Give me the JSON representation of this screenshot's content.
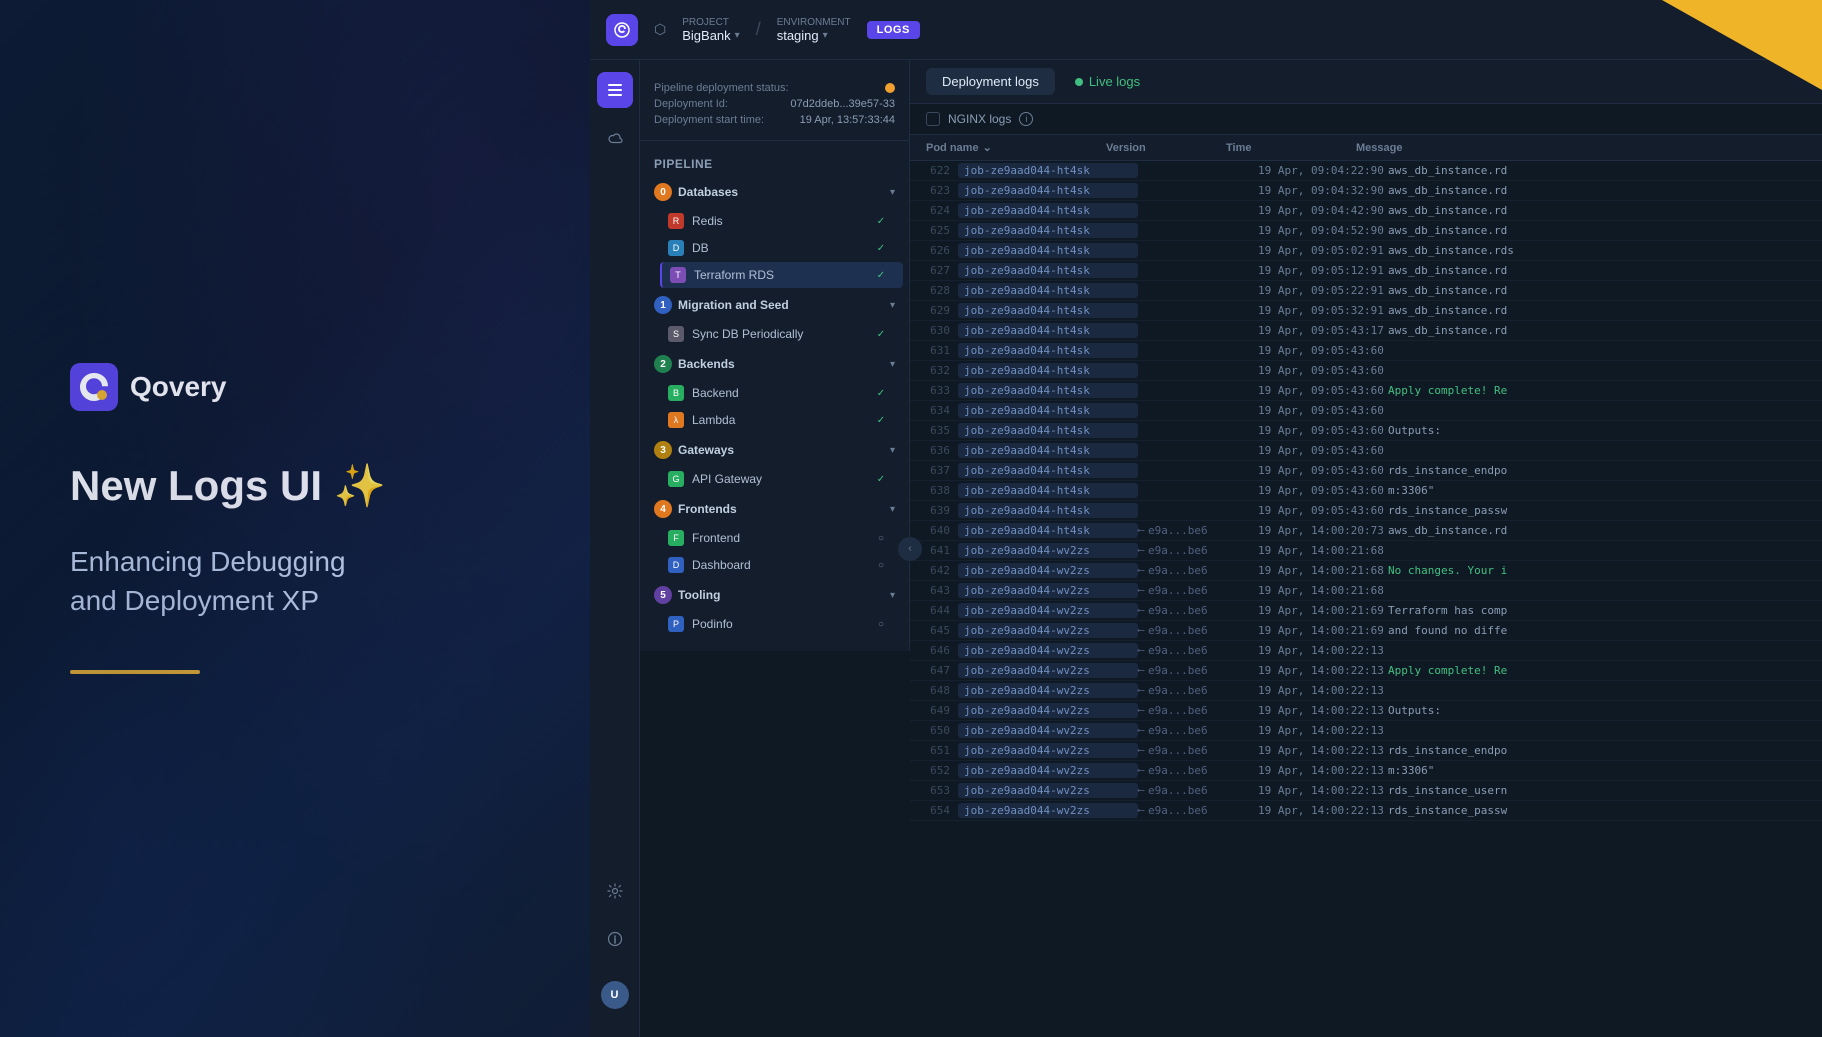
{
  "left": {
    "logo_text": "Qovery",
    "title": "New Logs UI ✨",
    "subtitle": "Enhancing Debugging\nand Deployment XP"
  },
  "topbar": {
    "project_label": "Project",
    "project_name": "BigBank",
    "env_label": "Environment",
    "env_name": "staging",
    "logs_badge": "LOGS"
  },
  "deployment": {
    "status_label": "Pipeline deployment status:",
    "id_label": "Deployment Id:",
    "id_value": "07d2ddeb...39e57-33",
    "start_label": "Deployment start time:",
    "start_value": "19 Apr, 13:57:33:44"
  },
  "pipeline": {
    "title": "Pipeline",
    "groups": [
      {
        "id": 0,
        "badge_class": "orange",
        "name": "Databases",
        "items": [
          {
            "name": "Redis",
            "icon_class": "redis",
            "icon": "R",
            "status": "success",
            "active": false
          },
          {
            "name": "DB",
            "icon_class": "db",
            "icon": "D",
            "status": "success",
            "active": false
          },
          {
            "name": "Terraform RDS",
            "icon_class": "terraform",
            "icon": "T",
            "status": "success",
            "active": true
          }
        ]
      },
      {
        "id": 1,
        "badge_class": "blue",
        "name": "Migration and Seed",
        "items": [
          {
            "name": "Sync DB Periodically",
            "icon_class": "seed",
            "icon": "S",
            "status": "success",
            "active": false
          }
        ]
      },
      {
        "id": 2,
        "badge_class": "green-badge",
        "name": "Backends",
        "items": [
          {
            "name": "Backend",
            "icon_class": "backend",
            "icon": "B",
            "status": "success",
            "active": false
          },
          {
            "name": "Lambda",
            "icon_class": "lambda",
            "icon": "λ",
            "status": "success",
            "active": false
          }
        ]
      },
      {
        "id": 3,
        "badge_class": "yellow-badge",
        "name": "Gateways",
        "items": [
          {
            "name": "API Gateway",
            "icon_class": "gateway",
            "icon": "G",
            "status": "success",
            "active": false
          }
        ]
      },
      {
        "id": 4,
        "badge_class": "orange",
        "name": "Frontends",
        "items": [
          {
            "name": "Frontend",
            "icon_class": "frontend",
            "icon": "F",
            "status": "pending",
            "active": false
          },
          {
            "name": "Dashboard",
            "icon_class": "dashboard",
            "icon": "D",
            "status": "pending",
            "active": false
          }
        ]
      },
      {
        "id": 5,
        "badge_class": "purple",
        "name": "Tooling",
        "items": [
          {
            "name": "Podinfo",
            "icon_class": "tooling",
            "icon": "P",
            "status": "pending",
            "active": false
          }
        ]
      }
    ]
  },
  "logs": {
    "tabs": [
      {
        "label": "Deployment logs",
        "active": true
      },
      {
        "label": "Live logs",
        "active": false,
        "live": true
      }
    ],
    "nginx_label": "NGINX logs",
    "columns": [
      "Pod name",
      "Version",
      "Time",
      "Message"
    ],
    "rows": [
      {
        "num": "622",
        "pod": "job-ze9aad044-ht4sk",
        "version": "",
        "time": "19 Apr, 09:04:22:90",
        "msg": "aws_db_instance.rd",
        "highlight": false
      },
      {
        "num": "623",
        "pod": "job-ze9aad044-ht4sk",
        "version": "",
        "time": "19 Apr, 09:04:32:90",
        "msg": "aws_db_instance.rd",
        "highlight": false
      },
      {
        "num": "624",
        "pod": "job-ze9aad044-ht4sk",
        "version": "",
        "time": "19 Apr, 09:04:42:90",
        "msg": "aws_db_instance.rd",
        "highlight": false
      },
      {
        "num": "625",
        "pod": "job-ze9aad044-ht4sk",
        "version": "",
        "time": "19 Apr, 09:04:52:90",
        "msg": "aws_db_instance.rd",
        "highlight": false
      },
      {
        "num": "626",
        "pod": "job-ze9aad044-ht4sk",
        "version": "",
        "time": "19 Apr, 09:05:02:91",
        "msg": "aws_db_instance.rds",
        "highlight": false
      },
      {
        "num": "627",
        "pod": "job-ze9aad044-ht4sk",
        "version": "",
        "time": "19 Apr, 09:05:12:91",
        "msg": "aws_db_instance.rd",
        "highlight": false
      },
      {
        "num": "628",
        "pod": "job-ze9aad044-ht4sk",
        "version": "",
        "time": "19 Apr, 09:05:22:91",
        "msg": "aws_db_instance.rd",
        "highlight": false
      },
      {
        "num": "629",
        "pod": "job-ze9aad044-ht4sk",
        "version": "",
        "time": "19 Apr, 09:05:32:91",
        "msg": "aws_db_instance.rd",
        "highlight": false
      },
      {
        "num": "630",
        "pod": "job-ze9aad044-ht4sk",
        "version": "",
        "time": "19 Apr, 09:05:43:17",
        "msg": "aws_db_instance.rd",
        "highlight": false
      },
      {
        "num": "631",
        "pod": "job-ze9aad044-ht4sk",
        "version": "",
        "time": "19 Apr, 09:05:43:60",
        "msg": "",
        "highlight": false
      },
      {
        "num": "632",
        "pod": "job-ze9aad044-ht4sk",
        "version": "",
        "time": "19 Apr, 09:05:43:60",
        "msg": "",
        "highlight": false
      },
      {
        "num": "633",
        "pod": "job-ze9aad044-ht4sk",
        "version": "",
        "time": "19 Apr, 09:05:43:60",
        "msg": "Apply complete! Re",
        "highlight": false,
        "msg_class": "green"
      },
      {
        "num": "634",
        "pod": "job-ze9aad044-ht4sk",
        "version": "",
        "time": "19 Apr, 09:05:43:60",
        "msg": "",
        "highlight": false
      },
      {
        "num": "635",
        "pod": "job-ze9aad044-ht4sk",
        "version": "",
        "time": "19 Apr, 09:05:43:60",
        "msg": "Outputs:",
        "highlight": false
      },
      {
        "num": "636",
        "pod": "job-ze9aad044-ht4sk",
        "version": "",
        "time": "19 Apr, 09:05:43:60",
        "msg": "",
        "highlight": false
      },
      {
        "num": "637",
        "pod": "job-ze9aad044-ht4sk",
        "version": "",
        "time": "19 Apr, 09:05:43:60",
        "msg": "rds_instance_endpo",
        "highlight": false
      },
      {
        "num": "638",
        "pod": "job-ze9aad044-ht4sk",
        "version": "",
        "time": "19 Apr, 09:05:43:60",
        "msg": "m:3306\"",
        "highlight": false
      },
      {
        "num": "639",
        "pod": "job-ze9aad044-ht4sk",
        "version": "",
        "time": "19 Apr, 09:05:43:60",
        "msg": "rds_instance_passw",
        "highlight": false
      },
      {
        "num": "640",
        "pod": "job-ze9aad044-ht4sk",
        "version": "e9a...be6",
        "time": "19 Apr, 14:00:20:73",
        "msg": "aws_db_instance.rd",
        "highlight": false,
        "has_version": true
      },
      {
        "num": "641",
        "pod": "job-ze9aad044-wv2zs",
        "version": "e9a...be6",
        "time": "19 Apr, 14:00:21:68",
        "msg": "",
        "highlight": false,
        "has_version": true
      },
      {
        "num": "642",
        "pod": "job-ze9aad044-wv2zs",
        "version": "e9a...be6",
        "time": "19 Apr, 14:00:21:68",
        "msg": "No changes. Your i",
        "highlight": false,
        "has_version": true,
        "msg_class": "green"
      },
      {
        "num": "643",
        "pod": "job-ze9aad044-wv2zs",
        "version": "e9a...be6",
        "time": "19 Apr, 14:00:21:68",
        "msg": "",
        "highlight": false,
        "has_version": true
      },
      {
        "num": "644",
        "pod": "job-ze9aad044-wv2zs",
        "version": "e9a...be6",
        "time": "19 Apr, 14:00:21:69",
        "msg": "Terraform has comp",
        "highlight": false,
        "has_version": true
      },
      {
        "num": "645",
        "pod": "job-ze9aad044-wv2zs",
        "version": "e9a...be6",
        "time": "19 Apr, 14:00:21:69",
        "msg": "and found no diffe",
        "highlight": false,
        "has_version": true
      },
      {
        "num": "646",
        "pod": "job-ze9aad044-wv2zs",
        "version": "e9a...be6",
        "time": "19 Apr, 14:00:22:13",
        "msg": "",
        "highlight": false,
        "has_version": true
      },
      {
        "num": "647",
        "pod": "job-ze9aad044-wv2zs",
        "version": "e9a...be6",
        "time": "19 Apr, 14:00:22:13",
        "msg": "Apply complete! Re",
        "highlight": false,
        "has_version": true,
        "msg_class": "green"
      },
      {
        "num": "648",
        "pod": "job-ze9aad044-wv2zs",
        "version": "e9a...be6",
        "time": "19 Apr, 14:00:22:13",
        "msg": "",
        "highlight": false,
        "has_version": true
      },
      {
        "num": "649",
        "pod": "job-ze9aad044-wv2zs",
        "version": "e9a...be6",
        "time": "19 Apr, 14:00:22:13",
        "msg": "Outputs:",
        "highlight": false,
        "has_version": true
      },
      {
        "num": "650",
        "pod": "job-ze9aad044-wv2zs",
        "version": "e9a...be6",
        "time": "19 Apr, 14:00:22:13",
        "msg": "",
        "highlight": false,
        "has_version": true
      },
      {
        "num": "651",
        "pod": "job-ze9aad044-wv2zs",
        "version": "e9a...be6",
        "time": "19 Apr, 14:00:22:13",
        "msg": "rds_instance_endpo",
        "highlight": false,
        "has_version": true
      },
      {
        "num": "652",
        "pod": "job-ze9aad044-wv2zs",
        "version": "e9a...be6",
        "time": "19 Apr, 14:00:22:13",
        "msg": "m:3306\"",
        "highlight": false,
        "has_version": true
      },
      {
        "num": "653",
        "pod": "job-ze9aad044-wv2zs",
        "version": "e9a...be6",
        "time": "19 Apr, 14:00:22:13",
        "msg": "rds_instance_usern",
        "highlight": false,
        "has_version": true
      },
      {
        "num": "654",
        "pod": "job-ze9aad044-wv2zs",
        "version": "e9a...be6",
        "time": "19 Apr, 14:00:22:13",
        "msg": "rds_instance_passw",
        "highlight": false,
        "has_version": true
      }
    ]
  }
}
